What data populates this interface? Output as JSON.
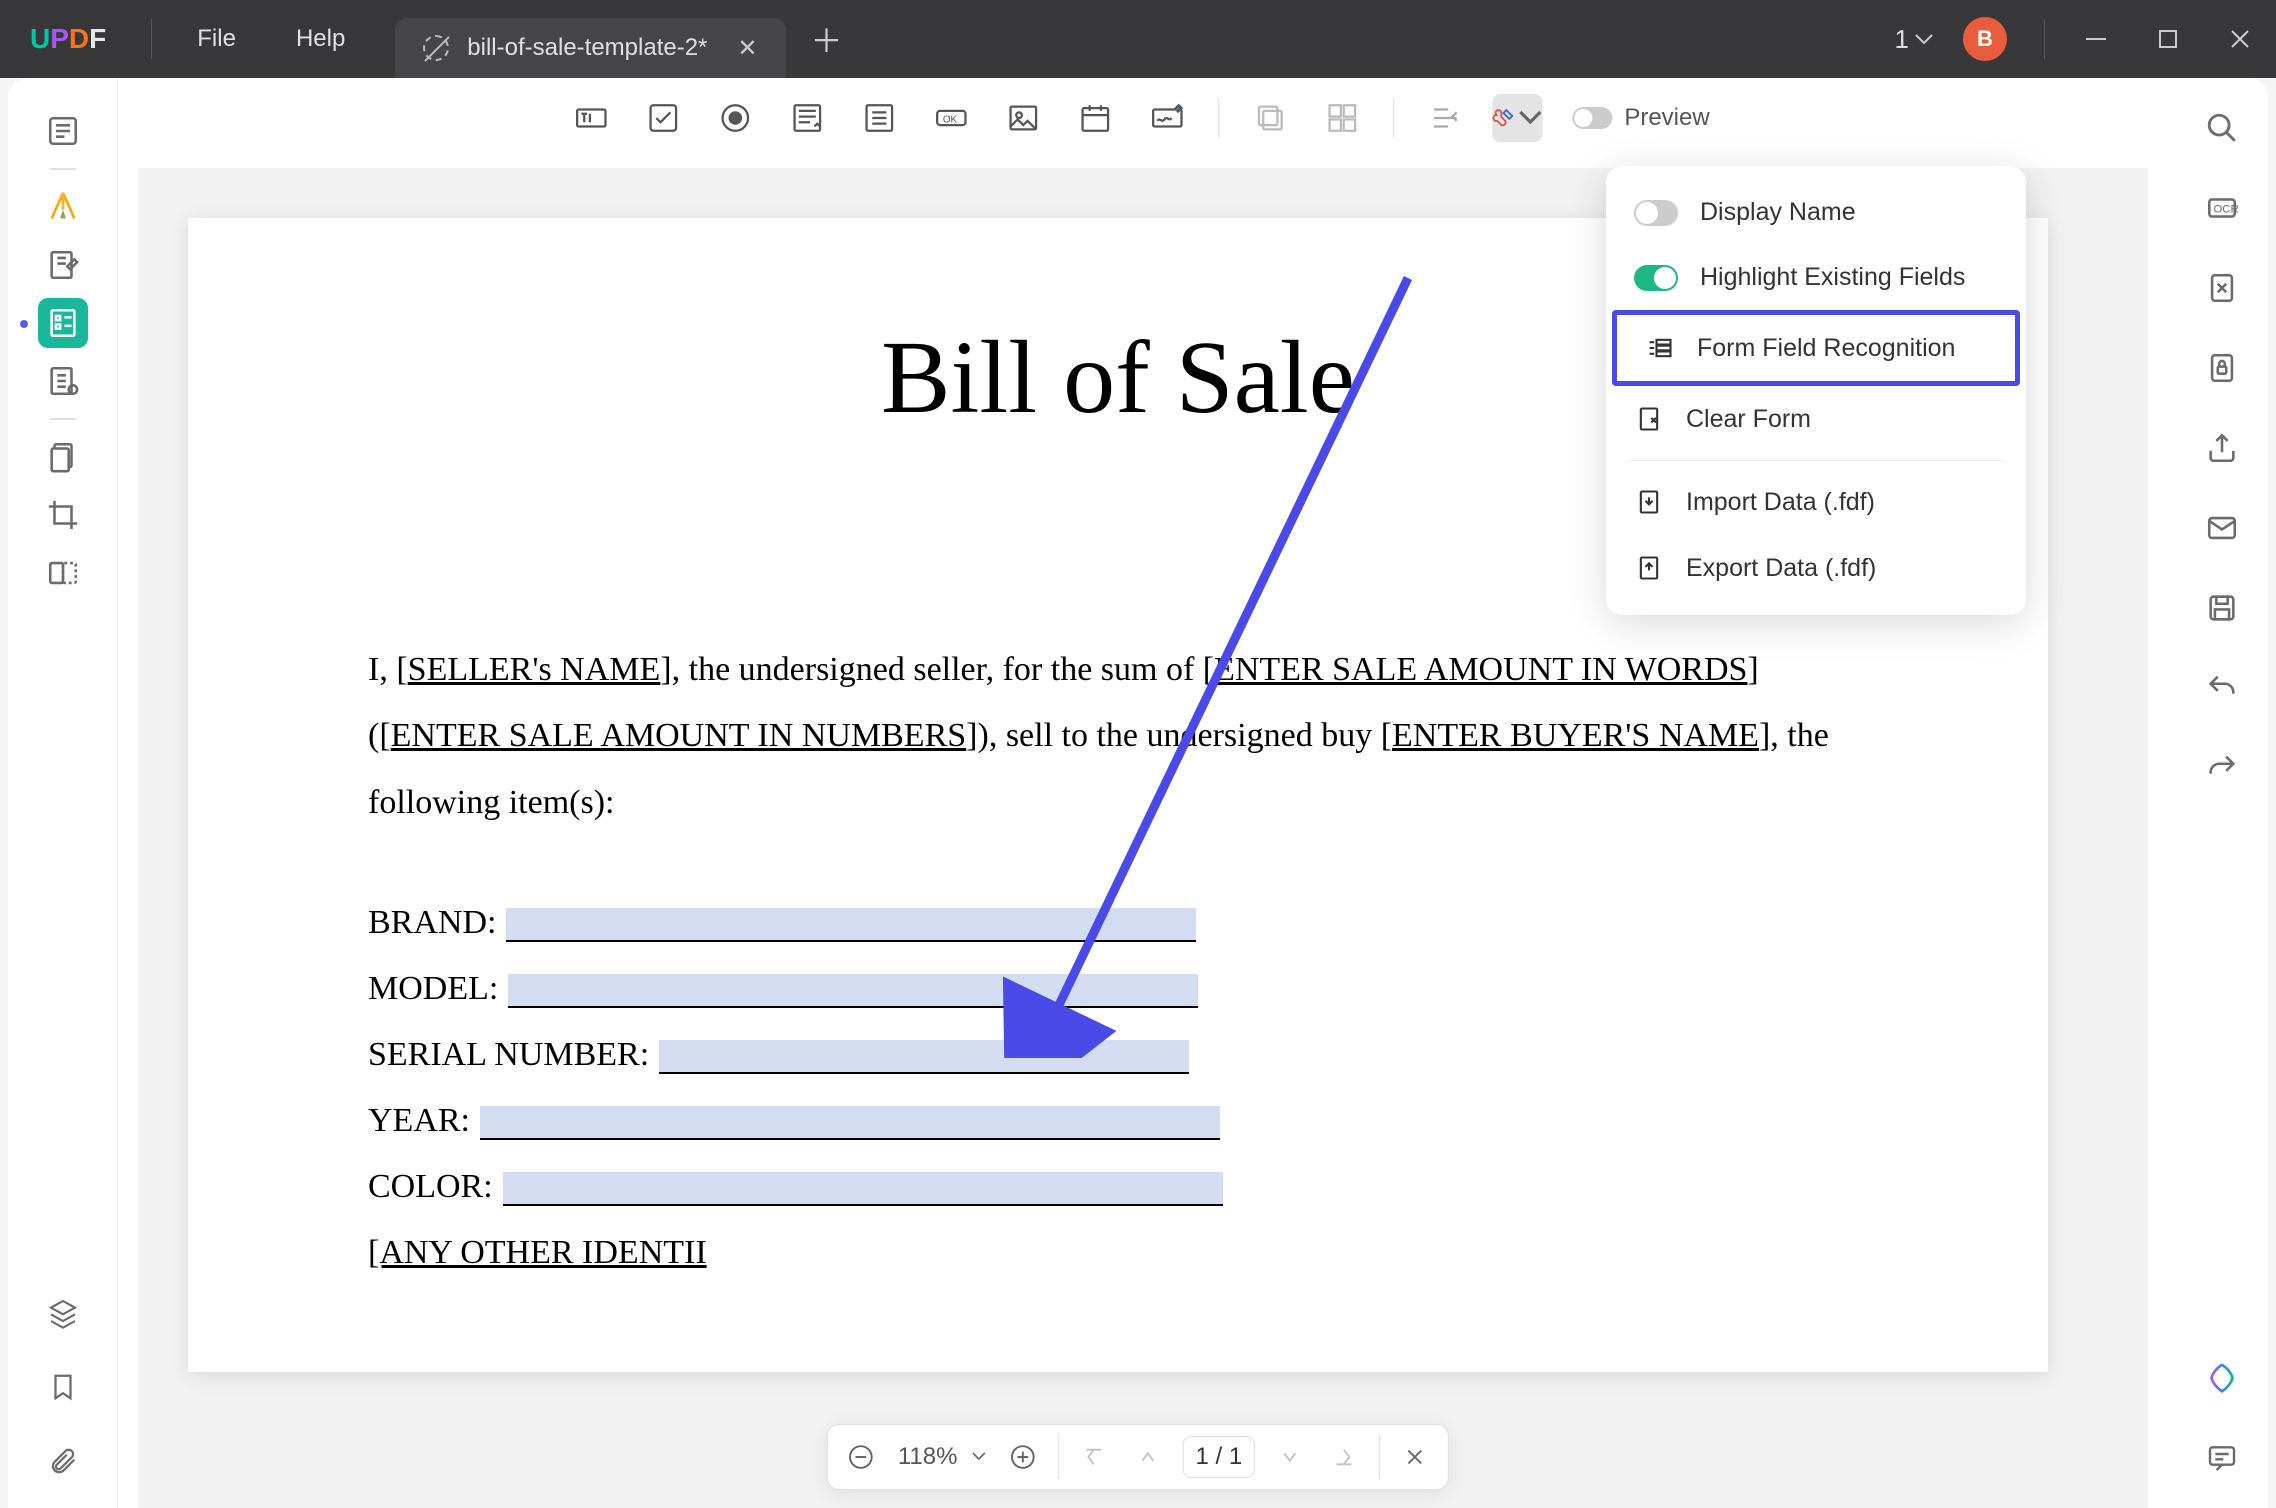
{
  "titlebar": {
    "file_menu": "File",
    "help_menu": "Help",
    "tab_title": "bill-of-sale-template-2*",
    "window_count": "1",
    "avatar_letter": "B"
  },
  "toolbar": {
    "preview_label": "Preview"
  },
  "dropdown": {
    "display_name": "Display Name",
    "highlight_fields": "Highlight Existing Fields",
    "form_recognition": "Form Field Recognition",
    "clear_form": "Clear Form",
    "import_data": "Import Data (.fdf)",
    "export_data": "Export Data (.fdf)"
  },
  "document": {
    "title": "Bill of Sale",
    "para_1_a": "I, [",
    "para_1_seller": "SELLER's NAME",
    "para_1_b": "], the undersigned seller, for the sum of [",
    "para_1_amount_words": "ENTER SALE AMOUNT IN WORDS",
    "para_1_c": "] ([",
    "para_1_amount_num": "ENTER SALE AMOUNT IN NUMBERS",
    "para_1_d": "]), sell to the undersigned buy [",
    "para_1_buyer": "ENTER BUYER'S NAME",
    "para_1_e": "], the following item(s):",
    "fields": {
      "brand": "BRAND:",
      "model": "MODEL:",
      "serial": "SERIAL NUMBER:",
      "year": "YEAR:",
      "color": "COLOR:",
      "other": "[ANY OTHER IDENTII"
    }
  },
  "bottombar": {
    "zoom": "118%",
    "page_current": "1",
    "page_total": "1"
  }
}
